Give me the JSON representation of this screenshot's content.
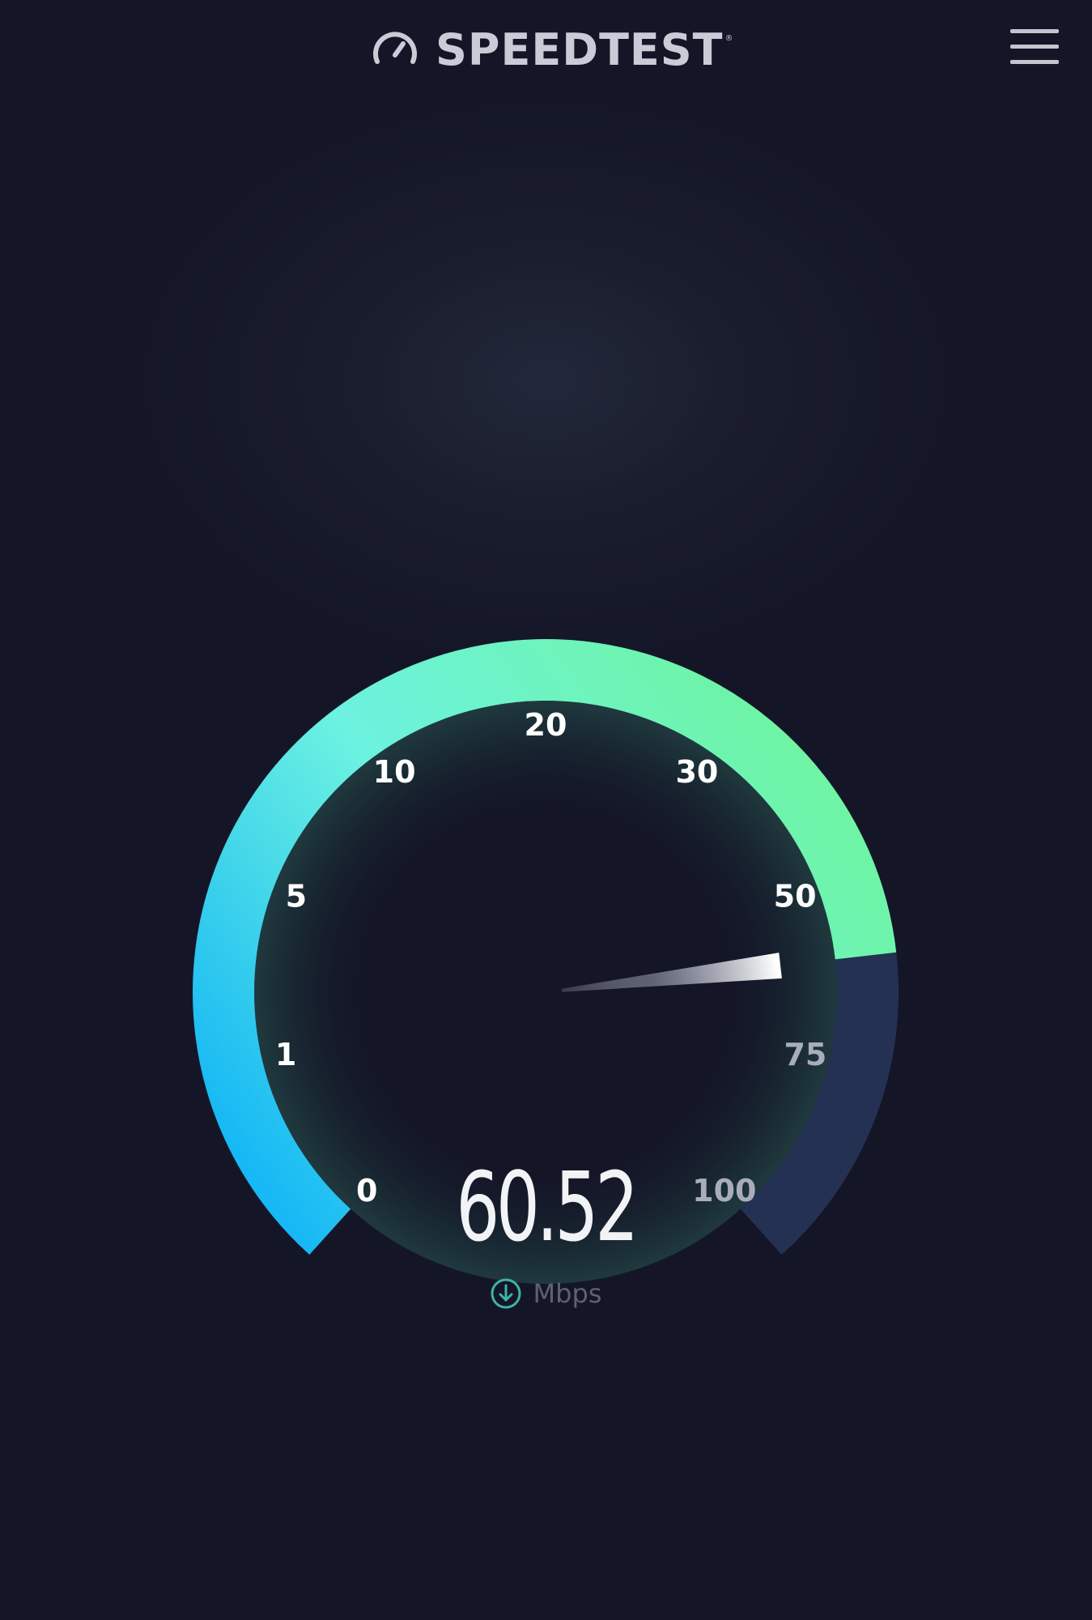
{
  "header": {
    "brand": "SPEEDTEST",
    "brand_mark": "®",
    "logo_icon": "gauge-icon",
    "menu_icon": "hamburger-menu-icon"
  },
  "gauge": {
    "tick_labels": [
      "0",
      "1",
      "5",
      "10",
      "20",
      "30",
      "50",
      "75",
      "100"
    ],
    "current_value": 60.52,
    "unit": "Mbps",
    "direction_icon": "download-arrow-icon",
    "colors": {
      "arc_start": "#16b8f5",
      "arc_mid": "#6cf2e0",
      "arc_end": "#6ff59b",
      "arc_remaining": "#243152",
      "needle": "#ffffff",
      "tick_active": "#ffffff",
      "tick_inactive": "#a9adbb"
    }
  },
  "result": {
    "value_text": "60.52",
    "unit_text": "Mbps"
  }
}
